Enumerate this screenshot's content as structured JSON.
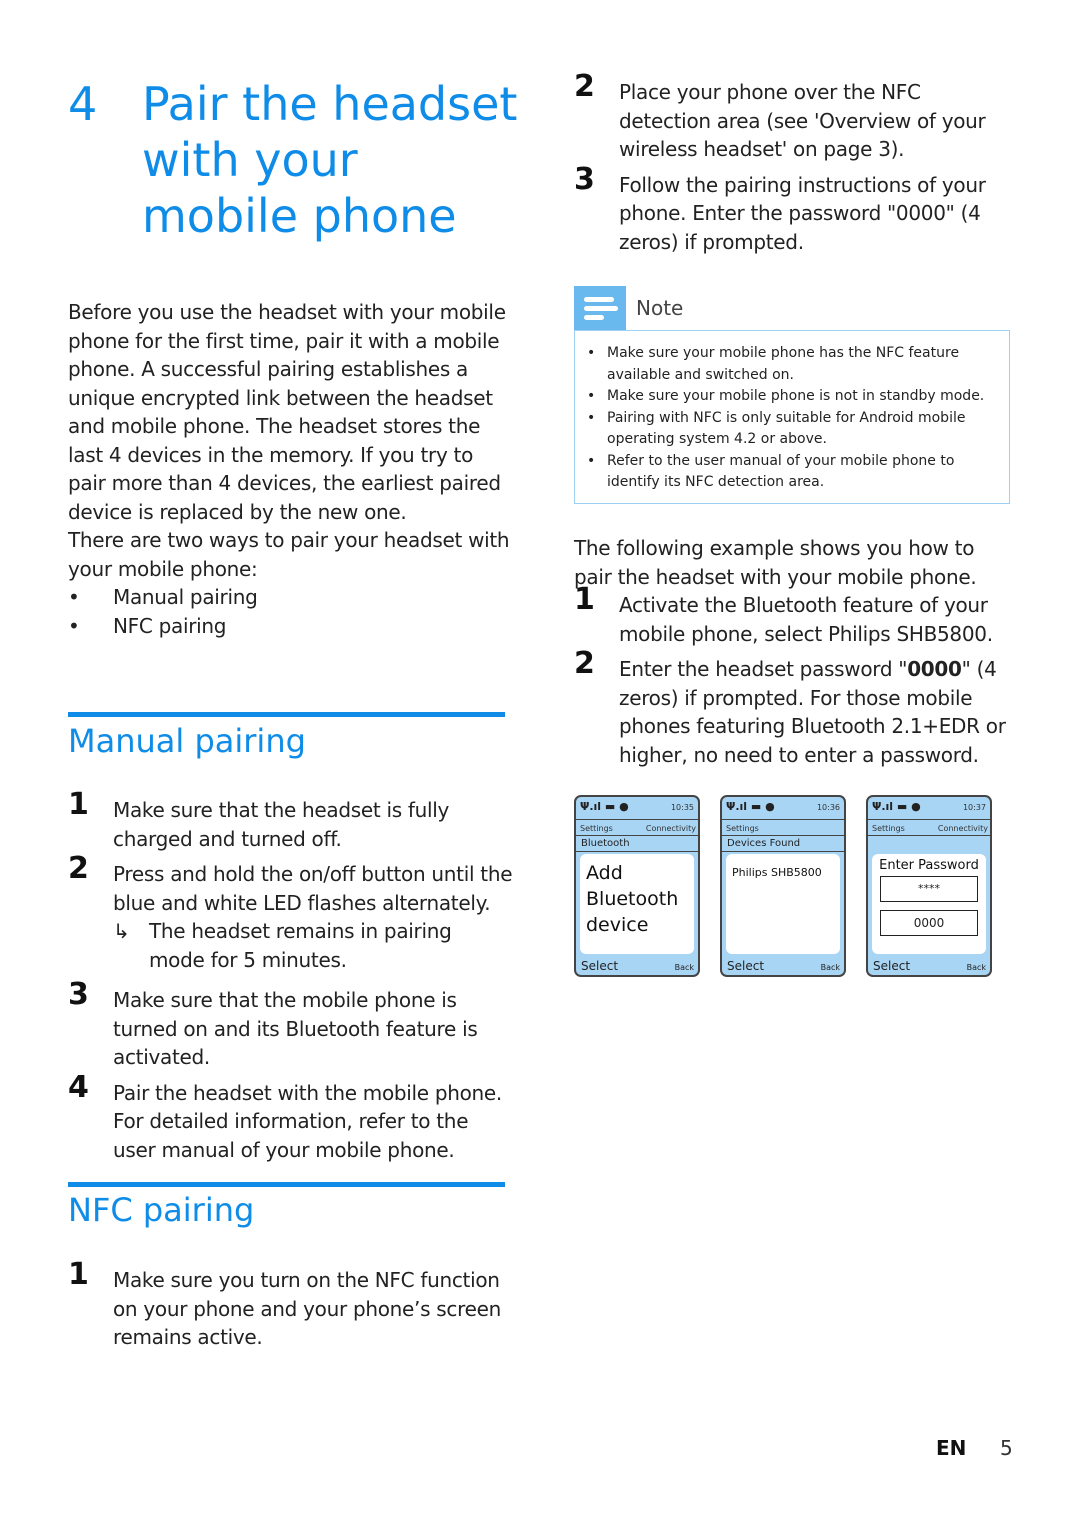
{
  "chapter": {
    "number": "4",
    "title_lines": [
      "Pair the headset",
      "with your",
      "mobile phone"
    ]
  },
  "intro": {
    "paragraph1": "Before you use the headset with your mobile phone for the first time, pair it with a mobile phone. A successful pairing establishes a unique encrypted link between the headset and mobile phone. The headset stores the last 4 devices in the memory. If you try to pair more than 4 devices, the earliest paired device is replaced by the new one.",
    "paragraph2": "There are two ways to pair your headset with your mobile phone:",
    "ways": [
      "Manual pairing",
      "NFC pairing"
    ]
  },
  "manual_pairing": {
    "heading": "Manual pairing",
    "steps": [
      {
        "num": "1",
        "text": "Make sure that the headset is fully charged and turned off."
      },
      {
        "num": "2",
        "text": "Press and hold the on/off button until the blue and white LED flashes alternately.",
        "result_arrow": "↳",
        "result": "The headset remains in pairing mode for 5 minutes."
      },
      {
        "num": "3",
        "text": "Make sure that the mobile phone is turned on and its Bluetooth feature is activated."
      },
      {
        "num": "4",
        "text": "Pair the headset with the mobile phone. For detailed information, refer to the user manual of your mobile phone."
      }
    ]
  },
  "nfc_pairing": {
    "heading": "NFC pairing",
    "steps": [
      {
        "num": "1",
        "text": "Make sure you turn on the NFC function on your phone and your phone’s screen remains active."
      },
      {
        "num": "2",
        "text": "Place your phone over the NFC detection area (see 'Overview of your wireless headset' on page 3)."
      },
      {
        "num": "3",
        "text": "Follow the pairing instructions of your phone. Enter the password \"0000\" (4 zeros) if prompted."
      }
    ]
  },
  "note": {
    "label": "Note",
    "items": [
      "Make sure your mobile phone has the NFC feature available and switched on.",
      "Make sure your mobile phone is not in standby mode.",
      "Pairing with NFC is only suitable for Android mobile operating system 4.2 or above.",
      "Refer to the user manual of your mobile phone to identify its NFC detection area."
    ]
  },
  "example": {
    "intro": "The following example shows you how to pair the headset with your mobile phone.",
    "steps": [
      {
        "num": "1",
        "text": "Activate the Bluetooth feature of your mobile phone, select Philips SHB5800."
      },
      {
        "num": "2",
        "text_before": "Enter the headset password \"",
        "bold": "0000",
        "text_after": "\" (4 zeros) if prompted. For those mobile phones featuring Bluetooth 2.1+EDR or higher, no need to enter a password."
      }
    ]
  },
  "phones": [
    {
      "status_icons": "Ψ.ıl ▬ ●",
      "time": "10:35",
      "nav_left": "Settings",
      "nav_right": "Connectivity",
      "sub": "Bluetooth",
      "content": "Add Bluetooth device",
      "soft_left": "Select",
      "soft_right": "Back"
    },
    {
      "status_icons": "Ψ.ıl ▬ ●",
      "time": "10:36",
      "nav_left": "Settings",
      "nav_right": "",
      "sub": "Devices Found",
      "content": "Philips SHB5800",
      "soft_left": "Select",
      "soft_right": "Back"
    },
    {
      "status_icons": "Ψ.ıl ▬ ●",
      "time": "10:37",
      "nav_left": "Settings",
      "nav_right": "Connectivity",
      "sub": "",
      "content_label": "Enter Password",
      "masked": "****",
      "password": "0000",
      "soft_left": "Select",
      "soft_right": "Back"
    }
  ],
  "footer": {
    "lang": "EN",
    "page": "5"
  },
  "colors": {
    "accent": "#0e8ce8",
    "note_tab": "#69b9ee",
    "note_border": "#9dd0f2",
    "phone_screen": "#a9d5f5"
  }
}
